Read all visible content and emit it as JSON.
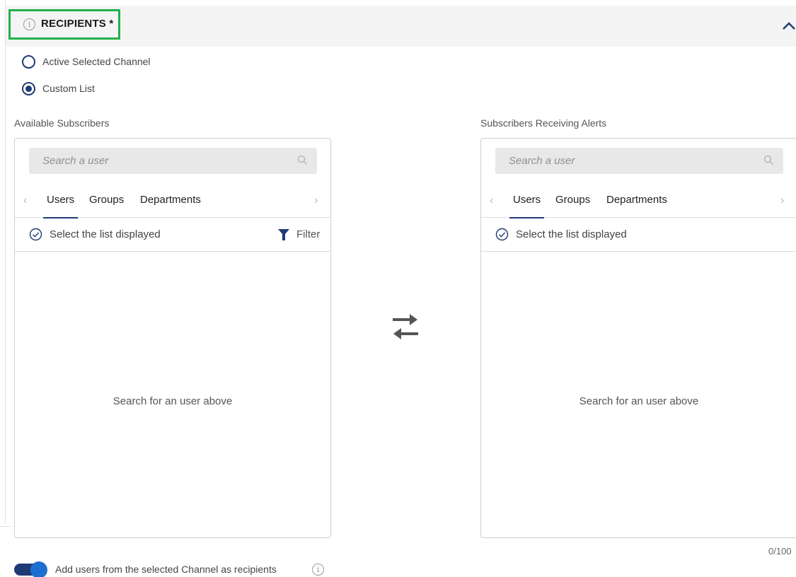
{
  "section": {
    "title": "RECIPIENTS *",
    "info_icon": "info-icon",
    "collapse_icon": "chevron-up-icon"
  },
  "recipient_mode": {
    "options": [
      {
        "label": "Active Selected Channel",
        "checked": false
      },
      {
        "label": "Custom List",
        "checked": true
      }
    ]
  },
  "available": {
    "title": "Available Subscribers",
    "search_placeholder": "Search a user",
    "tabs": [
      "Users",
      "Groups",
      "Departments"
    ],
    "active_tab": "Users",
    "select_label": "Select the list displayed",
    "filter_label": "Filter",
    "empty_message": "Search for an user above"
  },
  "receiving": {
    "title": "Subscribers Receiving Alerts",
    "search_placeholder": "Search a user",
    "tabs": [
      "Users",
      "Groups",
      "Departments"
    ],
    "active_tab": "Users",
    "select_label": "Select the list displayed",
    "empty_message": "Search for an user above",
    "counter": "0/100"
  },
  "add_from_channel": {
    "label": "Add users from the selected Channel as recipients",
    "enabled": true
  },
  "colors": {
    "accent": "#1f3b73",
    "toggle_knob": "#1c6fd1",
    "highlight_box": "#22b04b",
    "header_bg": "#f4f4f4",
    "search_bg": "#e8e8e8"
  }
}
